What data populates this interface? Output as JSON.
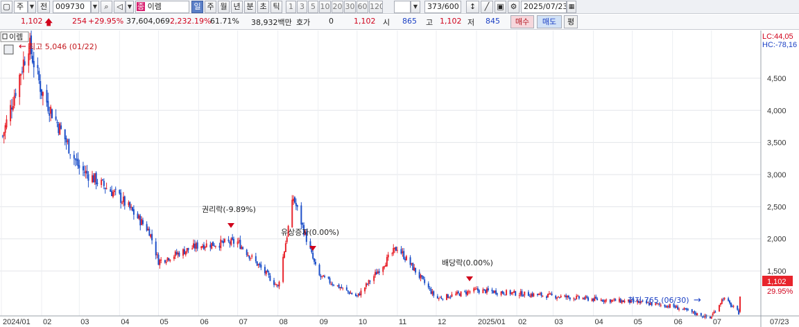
{
  "toolbar": {
    "market": "주",
    "chart_toggle": "전",
    "code": "009730",
    "name_prefix": "종",
    "name": "이렘",
    "period_units": [
      "일",
      "주",
      "월",
      "년",
      "분",
      "초",
      "틱"
    ],
    "period_numbers": [
      "1",
      "3",
      "5",
      "10",
      "20",
      "30",
      "60",
      "120"
    ],
    "count": "373/600",
    "date": "2025/07/23"
  },
  "info": {
    "price": "1,102",
    "change": "254",
    "change_pct": "+29.95%",
    "volume": "37,604,069",
    "volume_pct": "2,232.19%",
    "rate": "61.71%",
    "amount": "38,932백만",
    "quote_label": "호가",
    "quote_value": "0",
    "quote_price": "1,102",
    "open_label": "시",
    "open": "865",
    "high_label": "고",
    "high": "1,102",
    "low_label": "저",
    "low": "845",
    "buy_label": "매수",
    "sell_label": "매도",
    "eval_label": "평"
  },
  "chart": {
    "series_label": "이렘",
    "high_annotation": "최고 5,046 (01/22)",
    "low_annotation": "최저 765 (06/30)",
    "event_rights": "권리락(-9.89%)",
    "event_capital": "유상증자(0.00%)",
    "event_dividend": "배당락(0.00%)",
    "lc_label": "LC:44,05",
    "hc_label": "HC:-78,16",
    "price_tag": "1,102",
    "pct_tag": "29.95%",
    "up_color": "#e8242c",
    "down_color": "#1c4fc9"
  },
  "chart_data": {
    "type": "candlestick",
    "y_ticks": [
      "4,500",
      "4,000",
      "3,500",
      "3,000",
      "2,500",
      "2,000",
      "1,500"
    ],
    "ylim": [
      800,
      5200
    ],
    "x_labels": [
      "2024/01",
      "02",
      "03",
      "04",
      "05",
      "06",
      "07",
      "08",
      "09",
      "10",
      "11",
      "12",
      "2025/01",
      "02",
      "03",
      "04",
      "05",
      "06",
      "07",
      "07/23"
    ],
    "key_points": [
      {
        "date": "2024/01/02",
        "close": 3600
      },
      {
        "date": "2024/01/22",
        "high": 5046
      },
      {
        "date": "2024/02/01",
        "close": 4300
      },
      {
        "date": "2024/03/01",
        "close": 3100
      },
      {
        "date": "2024/04/01",
        "close": 2650
      },
      {
        "date": "2024/04/24",
        "close": 2120
      },
      {
        "date": "2024/05/01",
        "close": 1650
      },
      {
        "date": "2024/06/01",
        "close": 1900
      },
      {
        "date": "2024/07/01",
        "close": 1950
      },
      {
        "date": "2024/08/01",
        "close": 1250
      },
      {
        "date": "2024/08/13",
        "high": 2640
      },
      {
        "date": "2024/09/01",
        "close": 1430
      },
      {
        "date": "2024/10/01",
        "close": 1100
      },
      {
        "date": "2024/11/01",
        "high": 1870
      },
      {
        "date": "2024/12/01",
        "close": 1070
      },
      {
        "date": "2025/01/01",
        "close": 1200
      },
      {
        "date": "2025/02/01",
        "close": 1150
      },
      {
        "date": "2025/03/01",
        "close": 1110
      },
      {
        "date": "2025/04/01",
        "close": 1060
      },
      {
        "date": "2025/05/01",
        "close": 1020
      },
      {
        "date": "2025/06/01",
        "close": 950
      },
      {
        "date": "2025/06/30",
        "low": 765
      },
      {
        "date": "2025/07/10",
        "high": 1080
      },
      {
        "date": "2025/07/22",
        "close": 848
      },
      {
        "date": "2025/07/23",
        "open": 865,
        "high": 1102,
        "low": 845,
        "close": 1102
      }
    ]
  }
}
